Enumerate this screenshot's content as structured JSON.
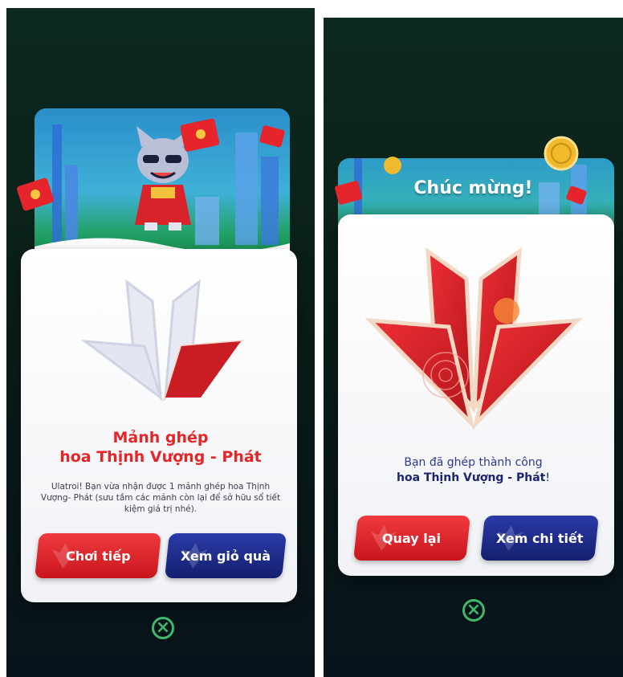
{
  "left_popup": {
    "title_line1": "Mảnh ghép",
    "title_line2": "hoa Thịnh Vượng - Phát",
    "description": "Ulatroi! Bạn vừa nhận được 1 mảnh ghép hoa Thịnh Vượng- Phát (sưu tầm các mảnh còn lại để sở hữu sổ tiết kiệm giá trị nhé).",
    "continue_button": "Chơi tiếp",
    "giftbox_button": "Xem giỏ quà"
  },
  "right_popup": {
    "banner_title": "Chúc mừng!",
    "success_line1": "Bạn đã ghép thành công",
    "success_line2_bold": "hoa Thịnh Vượng - Phát",
    "success_line2_end": "!",
    "back_button": "Quay lại",
    "detail_button": "Xem chi tiết"
  },
  "colors": {
    "red": "#e42629",
    "navy": "#1b2570",
    "green_close": "#3fb86b"
  },
  "icons": [
    "close-circle-icon",
    "vietcombank-flower-icon",
    "mascot-cat-illustration",
    "red-envelope-icon",
    "gold-coin-icon"
  ]
}
